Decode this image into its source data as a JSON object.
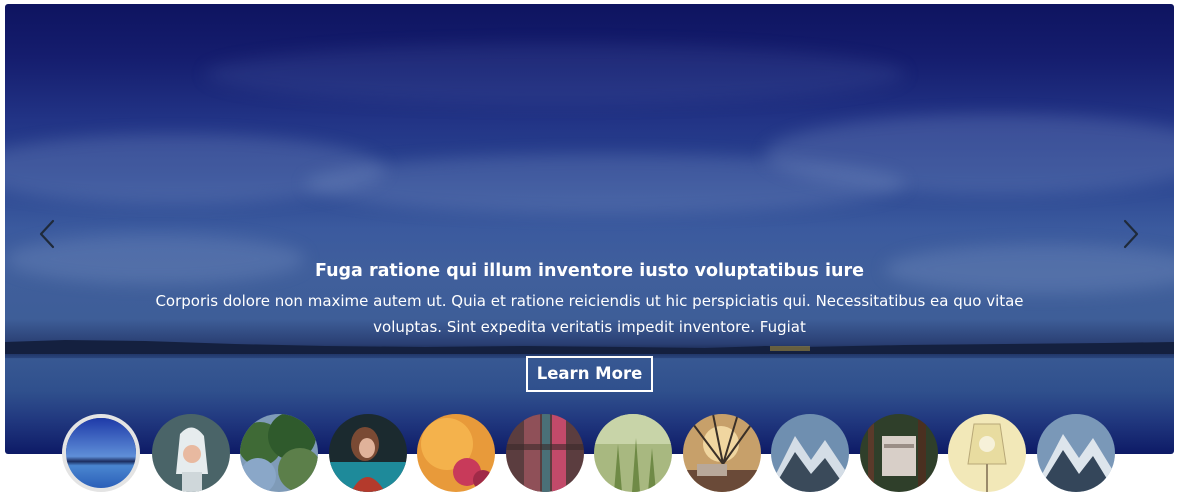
{
  "slide": {
    "title": "Fuga ratione qui illum inventore iusto voluptatibus iure",
    "text": "Corporis dolore non maxime autem ut. Quia et ratione reiciendis ut hic perspiciatis qui. Necessitatibus ea quo vitae voluptas. Sint expedita veritatis impedit inventore. Fugiat",
    "button_label": "Learn More"
  },
  "controls": {
    "prev_icon": "chevron-left-icon",
    "next_icon": "chevron-right-icon",
    "arrow_color": "#1f2a3a"
  },
  "thumbnails": {
    "count": 12,
    "active_index": 0,
    "items": [
      {
        "name": "thumb-lake"
      },
      {
        "name": "thumb-child-towel"
      },
      {
        "name": "thumb-trees"
      },
      {
        "name": "thumb-girl"
      },
      {
        "name": "thumb-fruit"
      },
      {
        "name": "thumb-fabric"
      },
      {
        "name": "thumb-grass"
      },
      {
        "name": "thumb-house-sunset"
      },
      {
        "name": "thumb-mountain"
      },
      {
        "name": "thumb-forest-sign"
      },
      {
        "name": "thumb-lamp"
      },
      {
        "name": "thumb-mountain-2"
      }
    ]
  }
}
